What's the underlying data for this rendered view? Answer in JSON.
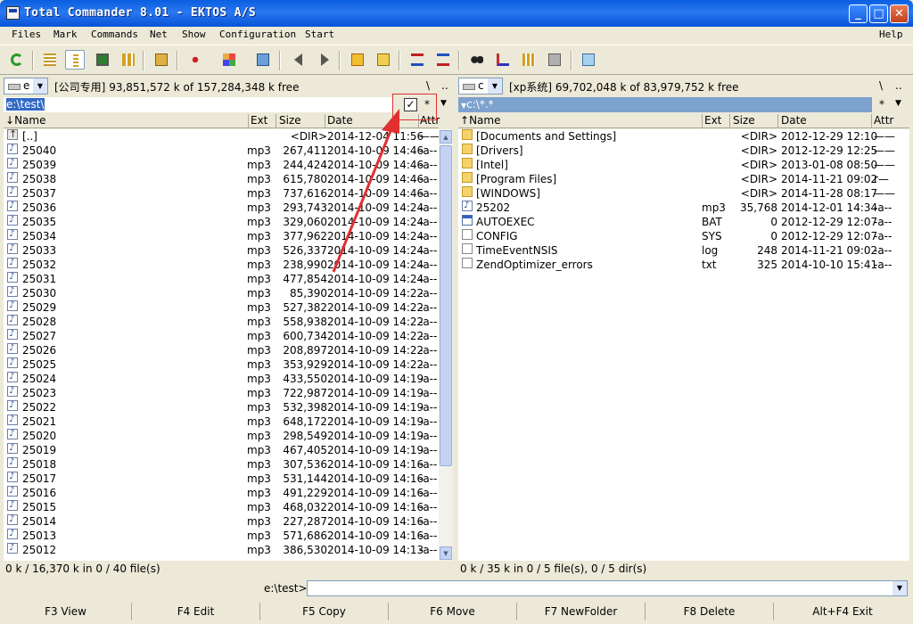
{
  "window": {
    "title": "Total Commander 8.01 - EKTOS A/S",
    "minimize": "_",
    "maximize": "□",
    "close": "✕"
  },
  "menu": [
    "Files",
    "Mark",
    "Commands",
    "Net",
    "Show",
    "Configuration",
    "Start",
    "Help"
  ],
  "toolbar_icons": [
    "refresh-icon",
    "brief-view-icon",
    "full-view-icon",
    "thumbnail-view-icon",
    "tree-view-icon",
    "compare-dirs-icon",
    "unpack-icon",
    "pack-icon",
    "copy-files-icon",
    "back-icon",
    "forward-icon",
    "zip-icon",
    "unzip-icon",
    "ftp-icon",
    "url-icon",
    "find-icon",
    "multi-rename-icon",
    "sync-dirs-icon",
    "calculator-icon",
    "notepad-icon"
  ],
  "left_panel": {
    "drive": "e",
    "volume": "[公司专用]",
    "free": "93,851,572 k of 157,284,348 k free",
    "nav_root": "\\",
    "nav_up": "..",
    "path": "e:\\test\\",
    "filter_star": "*",
    "headers": {
      "name": "Name",
      "ext": "Ext",
      "size": "Size",
      "date": "Date",
      "attr": "Attr"
    },
    "rows": [
      {
        "icon": "up",
        "name": "[..]",
        "ext": "",
        "size": "<DIR>",
        "date": "2014-12-04 11:56",
        "attr": "——"
      },
      {
        "icon": "mp3",
        "name": "25040",
        "ext": "mp3",
        "size": "267,411",
        "date": "2014-10-09 14:46",
        "attr": "-a--"
      },
      {
        "icon": "mp3",
        "name": "25039",
        "ext": "mp3",
        "size": "244,424",
        "date": "2014-10-09 14:46",
        "attr": "-a--"
      },
      {
        "icon": "mp3",
        "name": "25038",
        "ext": "mp3",
        "size": "615,780",
        "date": "2014-10-09 14:46",
        "attr": "-a--"
      },
      {
        "icon": "mp3",
        "name": "25037",
        "ext": "mp3",
        "size": "737,616",
        "date": "2014-10-09 14:46",
        "attr": "-a--"
      },
      {
        "icon": "mp3",
        "name": "25036",
        "ext": "mp3",
        "size": "293,743",
        "date": "2014-10-09 14:24",
        "attr": "-a--"
      },
      {
        "icon": "mp3",
        "name": "25035",
        "ext": "mp3",
        "size": "329,060",
        "date": "2014-10-09 14:24",
        "attr": "-a--"
      },
      {
        "icon": "mp3",
        "name": "25034",
        "ext": "mp3",
        "size": "377,962",
        "date": "2014-10-09 14:24",
        "attr": "-a--"
      },
      {
        "icon": "mp3",
        "name": "25033",
        "ext": "mp3",
        "size": "526,337",
        "date": "2014-10-09 14:24",
        "attr": "-a--"
      },
      {
        "icon": "mp3",
        "name": "25032",
        "ext": "mp3",
        "size": "238,990",
        "date": "2014-10-09 14:24",
        "attr": "-a--"
      },
      {
        "icon": "mp3",
        "name": "25031",
        "ext": "mp3",
        "size": "477,854",
        "date": "2014-10-09 14:24",
        "attr": "-a--"
      },
      {
        "icon": "mp3",
        "name": "25030",
        "ext": "mp3",
        "size": "85,390",
        "date": "2014-10-09 14:22",
        "attr": "-a--"
      },
      {
        "icon": "mp3",
        "name": "25029",
        "ext": "mp3",
        "size": "527,382",
        "date": "2014-10-09 14:22",
        "attr": "-a--"
      },
      {
        "icon": "mp3",
        "name": "25028",
        "ext": "mp3",
        "size": "558,938",
        "date": "2014-10-09 14:22",
        "attr": "-a--"
      },
      {
        "icon": "mp3",
        "name": "25027",
        "ext": "mp3",
        "size": "600,734",
        "date": "2014-10-09 14:22",
        "attr": "-a--"
      },
      {
        "icon": "mp3",
        "name": "25026",
        "ext": "mp3",
        "size": "208,897",
        "date": "2014-10-09 14:22",
        "attr": "-a--"
      },
      {
        "icon": "mp3",
        "name": "25025",
        "ext": "mp3",
        "size": "353,929",
        "date": "2014-10-09 14:22",
        "attr": "-a--"
      },
      {
        "icon": "mp3",
        "name": "25024",
        "ext": "mp3",
        "size": "433,550",
        "date": "2014-10-09 14:19",
        "attr": "-a--"
      },
      {
        "icon": "mp3",
        "name": "25023",
        "ext": "mp3",
        "size": "722,987",
        "date": "2014-10-09 14:19",
        "attr": "-a--"
      },
      {
        "icon": "mp3",
        "name": "25022",
        "ext": "mp3",
        "size": "532,398",
        "date": "2014-10-09 14:19",
        "attr": "-a--"
      },
      {
        "icon": "mp3",
        "name": "25021",
        "ext": "mp3",
        "size": "648,172",
        "date": "2014-10-09 14:19",
        "attr": "-a--"
      },
      {
        "icon": "mp3",
        "name": "25020",
        "ext": "mp3",
        "size": "298,549",
        "date": "2014-10-09 14:19",
        "attr": "-a--"
      },
      {
        "icon": "mp3",
        "name": "25019",
        "ext": "mp3",
        "size": "467,405",
        "date": "2014-10-09 14:19",
        "attr": "-a--"
      },
      {
        "icon": "mp3",
        "name": "25018",
        "ext": "mp3",
        "size": "307,536",
        "date": "2014-10-09 14:16",
        "attr": "-a--"
      },
      {
        "icon": "mp3",
        "name": "25017",
        "ext": "mp3",
        "size": "531,144",
        "date": "2014-10-09 14:16",
        "attr": "-a--"
      },
      {
        "icon": "mp3",
        "name": "25016",
        "ext": "mp3",
        "size": "491,229",
        "date": "2014-10-09 14:16",
        "attr": "-a--"
      },
      {
        "icon": "mp3",
        "name": "25015",
        "ext": "mp3",
        "size": "468,032",
        "date": "2014-10-09 14:16",
        "attr": "-a--"
      },
      {
        "icon": "mp3",
        "name": "25014",
        "ext": "mp3",
        "size": "227,287",
        "date": "2014-10-09 14:16",
        "attr": "-a--"
      },
      {
        "icon": "mp3",
        "name": "25013",
        "ext": "mp3",
        "size": "571,686",
        "date": "2014-10-09 14:16",
        "attr": "-a--"
      },
      {
        "icon": "mp3",
        "name": "25012",
        "ext": "mp3",
        "size": "386,530",
        "date": "2014-10-09 14:13",
        "attr": "-a--"
      }
    ],
    "status": "0 k / 16,370 k in 0 / 40 file(s)"
  },
  "right_panel": {
    "drive": "c",
    "volume": "[xp系统]",
    "free": "69,702,048 k of 83,979,752 k free",
    "nav_root": "\\",
    "nav_up": "..",
    "path": "c:\\*.*",
    "filter_star": "*",
    "headers": {
      "name": "Name",
      "ext": "Ext",
      "size": "Size",
      "date": "Date",
      "attr": "Attr"
    },
    "rows": [
      {
        "icon": "folder",
        "name": "[Documents and Settings]",
        "ext": "",
        "size": "<DIR>",
        "date": "2012-12-29 12:10",
        "attr": "——"
      },
      {
        "icon": "folder",
        "name": "[Drivers]",
        "ext": "",
        "size": "<DIR>",
        "date": "2012-12-29 12:25",
        "attr": "——"
      },
      {
        "icon": "folder",
        "name": "[Intel]",
        "ext": "",
        "size": "<DIR>",
        "date": "2013-01-08 08:50",
        "attr": "——"
      },
      {
        "icon": "folder",
        "name": "[Program Files]",
        "ext": "",
        "size": "<DIR>",
        "date": "2014-11-21 09:02",
        "attr": "r—"
      },
      {
        "icon": "folder",
        "name": "[WINDOWS]",
        "ext": "",
        "size": "<DIR>",
        "date": "2014-11-28 08:17",
        "attr": "——"
      },
      {
        "icon": "mp3",
        "name": "25202",
        "ext": "mp3",
        "size": "35,768",
        "date": "2014-12-01 14:34",
        "attr": "-a--"
      },
      {
        "icon": "exe",
        "name": "AUTOEXEC",
        "ext": "BAT",
        "size": "0",
        "date": "2012-12-29 12:07",
        "attr": "-a--"
      },
      {
        "icon": "doc",
        "name": "CONFIG",
        "ext": "SYS",
        "size": "0",
        "date": "2012-12-29 12:07",
        "attr": "-a--"
      },
      {
        "icon": "doc",
        "name": "TimeEventNSIS",
        "ext": "log",
        "size": "248",
        "date": "2014-11-21 09:02",
        "attr": "-a--"
      },
      {
        "icon": "doc",
        "name": "ZendOptimizer_errors",
        "ext": "txt",
        "size": "325",
        "date": "2014-10-10 15:41",
        "attr": "-a--"
      }
    ],
    "status": "0 k / 35 k in 0 / 5 file(s), 0 / 5 dir(s)"
  },
  "cmdline": {
    "label": "e:\\test>",
    "value": ""
  },
  "fkeys": [
    "F3 View",
    "F4 Edit",
    "F5 Copy",
    "F6 Move",
    "F7 NewFolder",
    "F8 Delete",
    "Alt+F4 Exit"
  ],
  "colors": {
    "title_blue": "#0a5ee0",
    "annotation_red": "#e03030",
    "selection_blue": "#316ac5"
  }
}
